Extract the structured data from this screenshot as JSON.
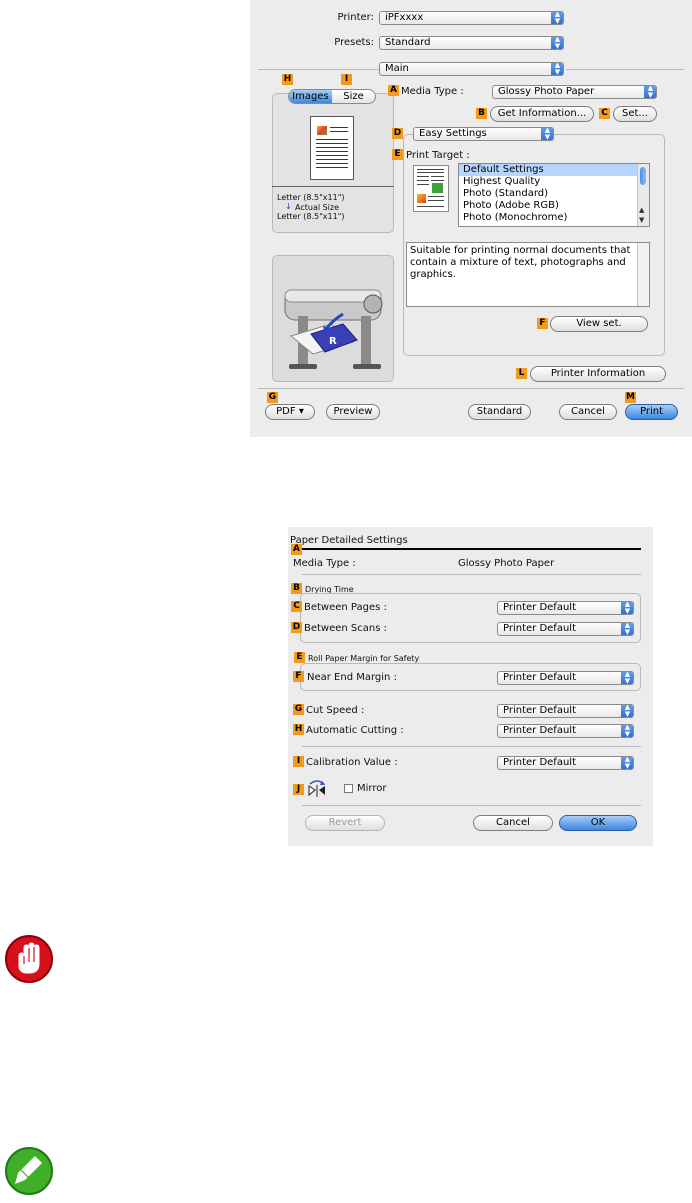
{
  "dialog1": {
    "printer_label": "Printer:",
    "printer_value": "iPFxxxx",
    "presets_label": "Presets:",
    "presets_value": "Standard",
    "panel_value": "Main",
    "tabs": [
      "Images",
      "Size"
    ],
    "tags": {
      "A": "A",
      "B": "B",
      "C": "C",
      "D": "D",
      "E": "E",
      "F": "F",
      "G": "G",
      "H": "H",
      "I": "I",
      "L": "L",
      "M": "M"
    },
    "preview_lines": [
      "Letter (8.5\"x11\")",
      "Actual Size",
      "Letter (8.5\"x11\")"
    ],
    "preview_arrow": "↓",
    "media_type_label": "Media Type :",
    "media_type_value": "Glossy Photo Paper",
    "get_info_button": "Get Information...",
    "set_button": "Set...",
    "mode_value": "Easy Settings",
    "print_target_label": "Print Target :",
    "print_targets": [
      "Default Settings",
      "Highest Quality",
      "Photo (Standard)",
      "Photo (Adobe RGB)",
      "Photo (Monochrome)"
    ],
    "selected_target": "Default Settings",
    "description": "Suitable for printing normal documents that contain a mixture of text, photographs and graphics.",
    "view_set_button": "View set.",
    "printer_info_button": "Printer Information",
    "pdf_button": "PDF ▾",
    "preview_button": "Preview",
    "standard_button": "Standard",
    "cancel_button": "Cancel",
    "print_button": "Print"
  },
  "dialog2": {
    "title": "Paper Detailed Settings",
    "media_type_label": "Media Type :",
    "media_type_value": "Glossy Photo Paper",
    "drying_time_label": "Drying Time",
    "between_pages_label": "Between Pages :",
    "between_pages_value": "Printer Default",
    "between_scans_label": "Between Scans :",
    "between_scans_value": "Printer Default",
    "roll_margin_label": "Roll Paper Margin for Safety",
    "near_end_label": "Near End Margin :",
    "near_end_value": "Printer Default",
    "cut_speed_label": "Cut Speed :",
    "cut_speed_value": "Printer Default",
    "auto_cut_label": "Automatic Cutting :",
    "auto_cut_value": "Printer Default",
    "calibration_label": "Calibration Value :",
    "calibration_value": "Printer Default",
    "mirror_label": "Mirror",
    "revert_button": "Revert",
    "cancel_button": "Cancel",
    "ok_button": "OK",
    "tags": {
      "A": "A",
      "B": "B",
      "C": "C",
      "D": "D",
      "E": "E",
      "F": "F",
      "G": "G",
      "H": "H",
      "I": "I",
      "J": "J"
    }
  },
  "icons": {
    "important": "hand-stop-icon",
    "note": "pencil-icon",
    "important_color": "#d8101a",
    "note_color": "#3fae29"
  }
}
